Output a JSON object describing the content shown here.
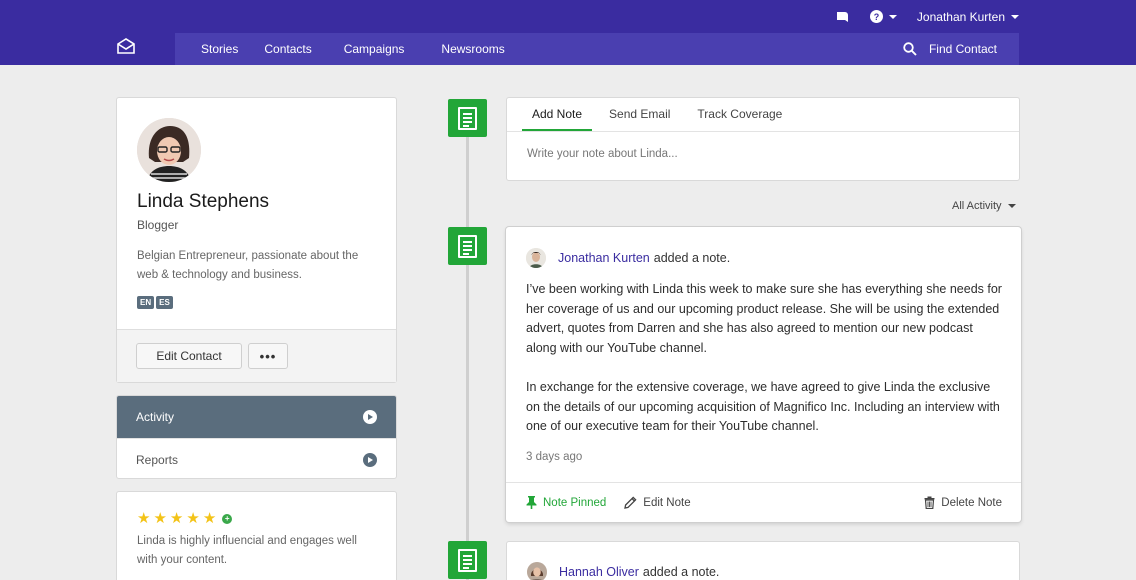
{
  "topbar": {
    "user_name": "Jonathan Kurten",
    "help_icon": "help-icon",
    "notification_icon": "chat-bubble-icon"
  },
  "nav": {
    "items": [
      {
        "label": "Stories"
      },
      {
        "label": "Contacts"
      },
      {
        "label": "Campaigns"
      },
      {
        "label": "Newsrooms"
      }
    ],
    "find_contact_label": "Find Contact"
  },
  "profile": {
    "name": "Linda Stephens",
    "role": "Blogger",
    "bio": "Belgian Entrepreneur, passionate about the web & technology and business.",
    "languages": [
      "EN",
      "ES"
    ],
    "edit_label": "Edit Contact",
    "more_label": "•••"
  },
  "sidemenu": {
    "items": [
      {
        "label": "Activity",
        "active": true
      },
      {
        "label": "Reports",
        "active": false
      }
    ]
  },
  "rating": {
    "stars": 5,
    "text": "Linda is highly influencial and engages well with your content."
  },
  "composer": {
    "tabs": [
      {
        "label": "Add Note",
        "active": true
      },
      {
        "label": "Send Email",
        "active": false
      },
      {
        "label": "Track Coverage",
        "active": false
      }
    ],
    "placeholder": "Write your note about Linda..."
  },
  "filter": {
    "label": "All Activity"
  },
  "activities": [
    {
      "author": "Jonathan Kurten",
      "action": "added a note.",
      "paragraphs": [
        "I’ve been working with Linda this week to make sure she has everything she needs for her coverage of us and our upcoming product release. She will be using the extended advert, quotes from Darren and she has also agreed to mention our new podcast along with our YouTube channel.",
        "In exchange for the extensive coverage, we have agreed to give Linda the exclusive on the details of our upcoming acquisition of Magnifico Inc. Including an interview with one of our executive team for their YouTube channel."
      ],
      "time": "3 days ago",
      "pinned_label": "Note Pinned",
      "edit_label": "Edit Note",
      "delete_label": "Delete Note"
    },
    {
      "author": "Hannah Oliver",
      "action": "added a note."
    }
  ],
  "colors": {
    "brand": "#3a2ca0",
    "accent_green": "#22a638",
    "slate": "#5a6d7d",
    "star": "#f3c317"
  }
}
